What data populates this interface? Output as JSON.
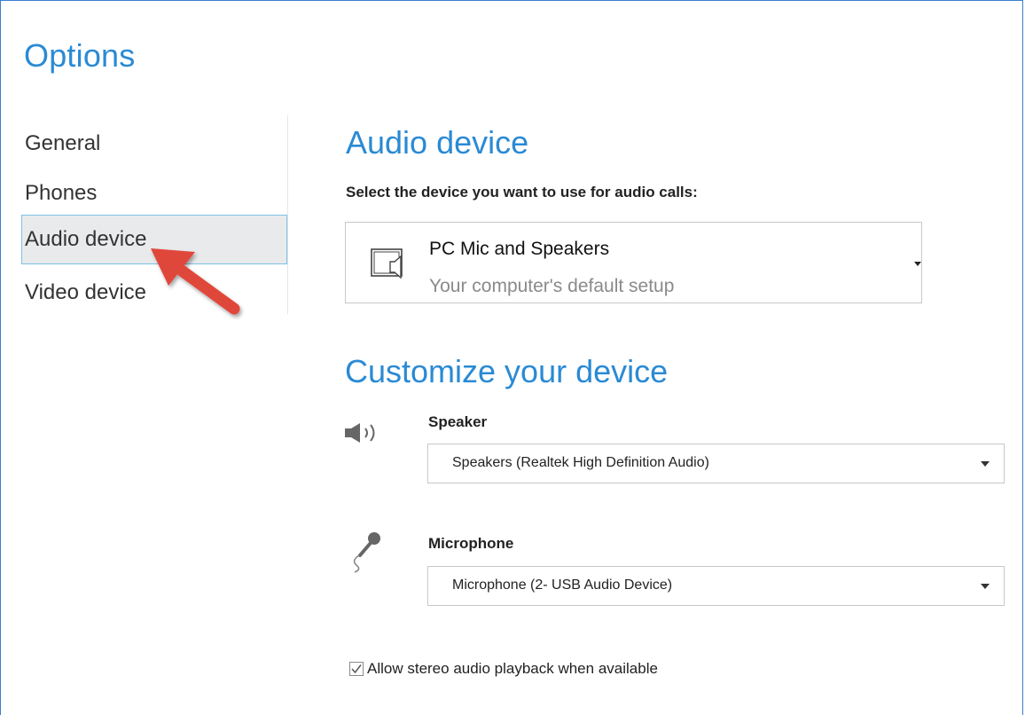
{
  "window": {
    "title": "Options"
  },
  "nav": {
    "items": [
      {
        "label": "General",
        "selected": false
      },
      {
        "label": "Phones",
        "selected": false
      },
      {
        "label": "Audio device",
        "selected": true
      },
      {
        "label": "Video device",
        "selected": false
      }
    ]
  },
  "audio_device": {
    "heading": "Audio device",
    "prompt": "Select the device you want to use for audio calls:",
    "selected_device": {
      "name": "PC Mic and Speakers",
      "description": "Your computer's default setup",
      "icon": "pc-speaker-icon"
    }
  },
  "customize": {
    "heading": "Customize your device",
    "speaker": {
      "label": "Speaker",
      "value": "Speakers (Realtek High Definition Audio)",
      "icon": "speaker-icon"
    },
    "microphone": {
      "label": "Microphone",
      "value": "Microphone (2- USB Audio Device)",
      "icon": "microphone-icon"
    }
  },
  "stereo": {
    "label": "Allow stereo audio playback when available",
    "checked": true
  },
  "colors": {
    "accent": "#2a8ad4",
    "annotation_arrow": "#e0463b",
    "selected_bg": "#e9eaec",
    "selected_border": "#7bc3e4"
  }
}
